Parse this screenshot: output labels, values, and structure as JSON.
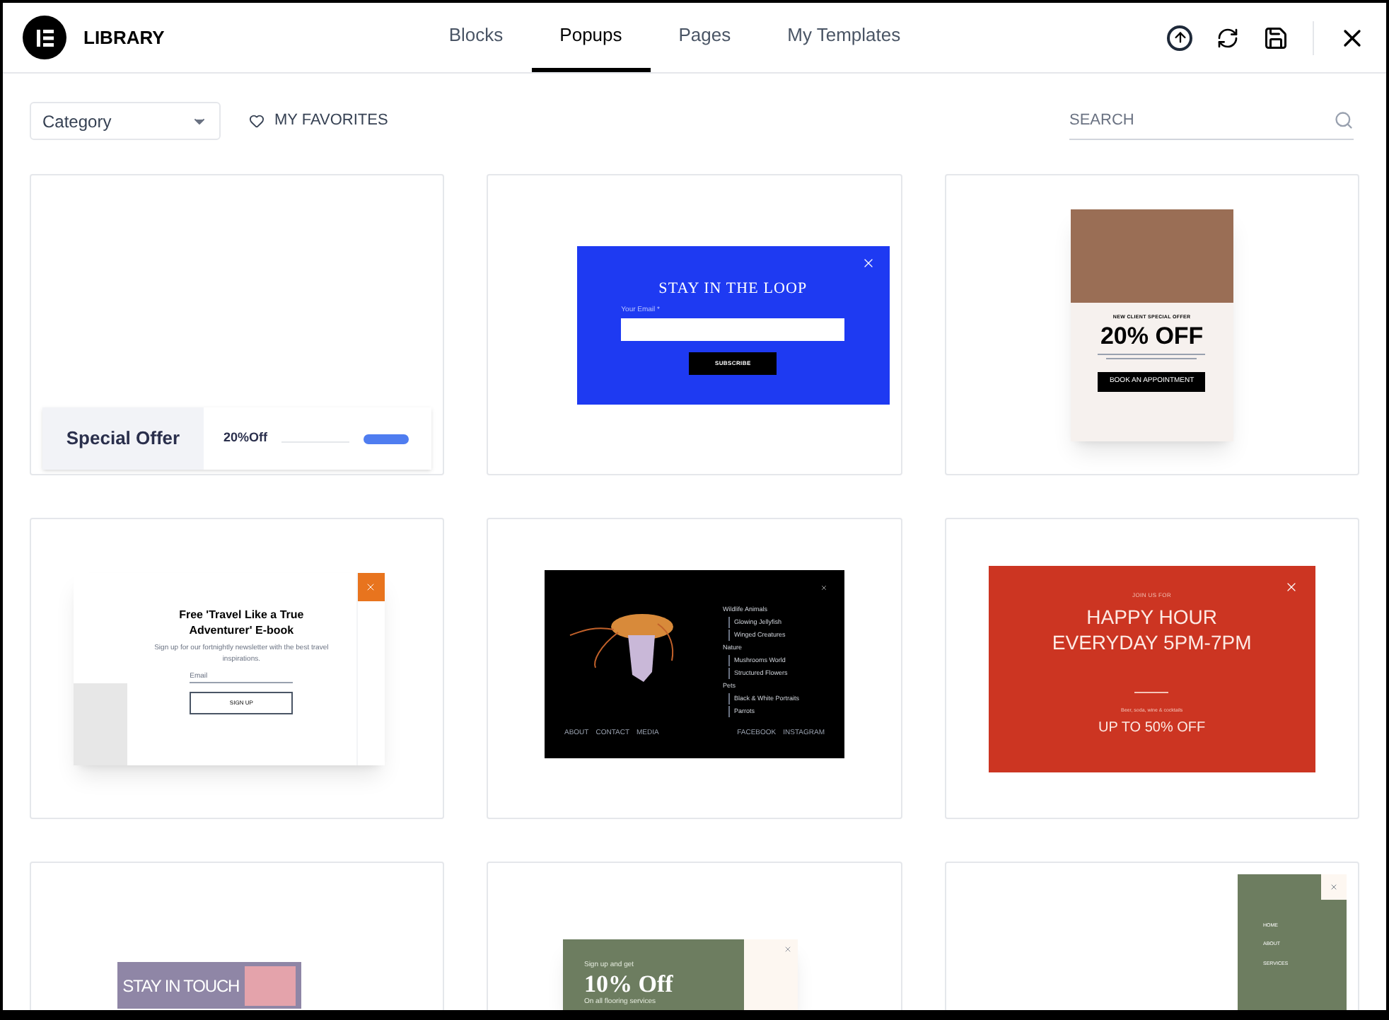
{
  "header": {
    "title": "LIBRARY",
    "tabs": [
      {
        "label": "Blocks",
        "selected": false
      },
      {
        "label": "Popups",
        "selected": true
      },
      {
        "label": "Pages",
        "selected": false
      },
      {
        "label": "My Templates",
        "selected": false
      }
    ]
  },
  "toolbar": {
    "category": "Category",
    "favorites": "MY FAVORITES",
    "search": {
      "placeholder": "SEARCH"
    }
  },
  "templates": [
    {
      "kind": "bottom-bar",
      "title": "Special Offer",
      "offer": "20%Off"
    },
    {
      "kind": "blue-newsletter",
      "title": "STAY IN THE LOOP",
      "field_label": "Your Email *",
      "button": "SUBSCRIBE"
    },
    {
      "kind": "beauty-offer",
      "eyebrow": "NEW CLIENT SPECIAL OFFER",
      "title": "20% OFF",
      "button": "BOOK AN APPOINTMENT"
    },
    {
      "kind": "ebook",
      "title": "Free 'Travel Like a True Adventurer' E-book",
      "body": "Sign up for our fortnightly newsletter with the best travel inspirations.",
      "placeholder": "Email",
      "button": "SIGN UP"
    },
    {
      "kind": "dark-menu",
      "menu": [
        {
          "label": "Wildlife Animals",
          "sub": false
        },
        {
          "label": "Glowing Jellyfish",
          "sub": true
        },
        {
          "label": "Winged Creatures",
          "sub": true
        },
        {
          "label": "Nature",
          "sub": false
        },
        {
          "label": "Mushrooms World",
          "sub": true
        },
        {
          "label": "Structured Flowers",
          "sub": true
        },
        {
          "label": "Pets",
          "sub": false
        },
        {
          "label": "Black & White Portraits",
          "sub": true
        },
        {
          "label": "Parrots",
          "sub": true
        }
      ],
      "footer_left": [
        "ABOUT",
        "CONTACT",
        "MEDIA"
      ],
      "footer_right": [
        "FACEBOOK",
        "INSTAGRAM"
      ]
    },
    {
      "kind": "happy-hour",
      "eyebrow": "JOIN US FOR",
      "title": "HAPPY HOUR EVERYDAY 5PM-7PM",
      "body": "Beer, soda, wine & cocktails",
      "offer": "UP TO 50% OFF"
    },
    {
      "kind": "stay-in-touch",
      "title": "STAY IN TOUCH"
    },
    {
      "kind": "green-offer",
      "eyebrow": "Sign up and get",
      "title": "10% Off",
      "body": "On all flooring services"
    },
    {
      "kind": "side-menu",
      "menu": [
        "HOME",
        "ABOUT",
        "SERVICES"
      ]
    }
  ]
}
